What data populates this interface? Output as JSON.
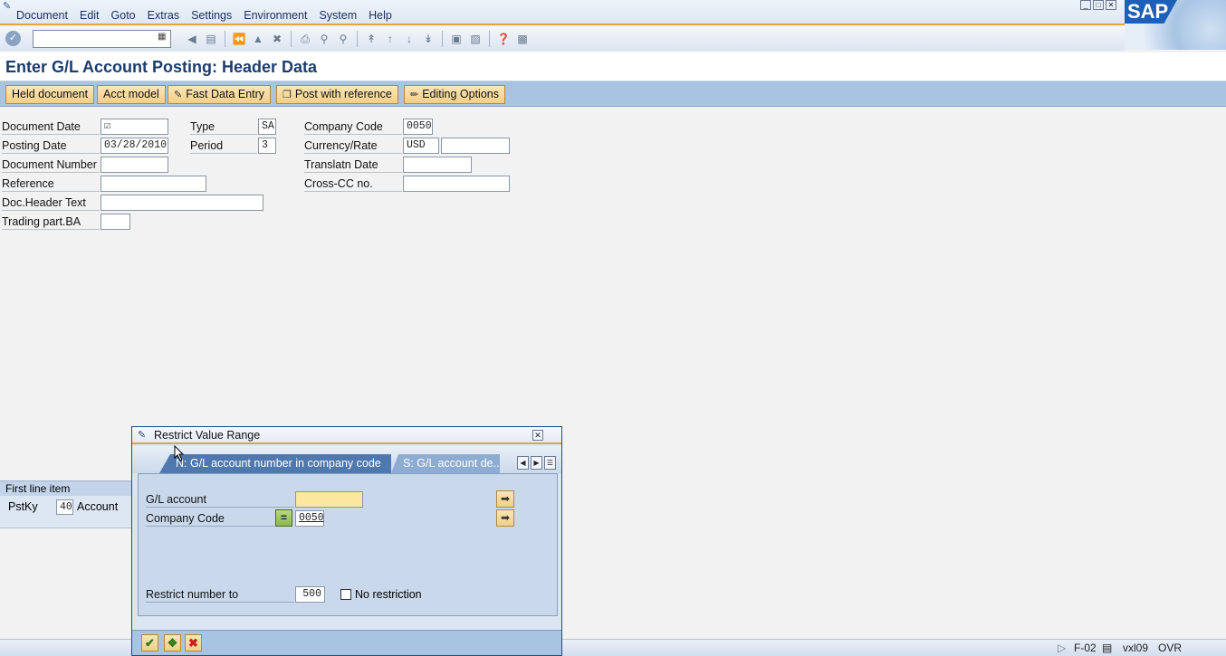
{
  "menu": {
    "items": [
      "Document",
      "Edit",
      "Goto",
      "Extras",
      "Settings",
      "Environment",
      "System",
      "Help"
    ]
  },
  "logo": {
    "text": "SAP"
  },
  "toolbar": {
    "command_value": "",
    "icons": [
      "enter-icon",
      "back-icon",
      "save-icon",
      "back-nav-icon",
      "exit-icon",
      "cancel-icon",
      "print-icon",
      "find-icon",
      "find-next-icon",
      "first-page-icon",
      "prev-page-icon",
      "next-page-icon",
      "last-page-icon",
      "new-session-icon",
      "shortcut-icon",
      "help-icon",
      "layout-icon"
    ]
  },
  "page": {
    "title": "Enter G/L Account Posting: Header Data"
  },
  "app_toolbar": {
    "held_document": "Held document",
    "acct_model": "Acct model",
    "fast_data_entry": "Fast Data Entry",
    "post_with_reference": "Post with reference",
    "editing_options": "Editing Options"
  },
  "header_form": {
    "document_date": {
      "label": "Document Date",
      "value": "☑"
    },
    "posting_date": {
      "label": "Posting Date",
      "value": "03/28/2010"
    },
    "document_number": {
      "label": "Document Number",
      "value": ""
    },
    "reference": {
      "label": "Reference",
      "value": ""
    },
    "doc_header_text": {
      "label": "Doc.Header Text",
      "value": ""
    },
    "trading_part_ba": {
      "label": "Trading part.BA",
      "value": ""
    },
    "type": {
      "label": "Type",
      "value": "SA"
    },
    "period": {
      "label": "Period",
      "value": "3"
    },
    "company_code": {
      "label": "Company Code",
      "value": "0050"
    },
    "currency_rate": {
      "label": "Currency/Rate",
      "value": "USD",
      "rate": ""
    },
    "translatn_date": {
      "label": "Translatn Date",
      "value": ""
    },
    "cross_cc_no": {
      "label": "Cross-CC no.",
      "value": ""
    }
  },
  "first_line_item": {
    "tab_label": "First line item",
    "pstky_label": "PstKy",
    "pstky_value": "40",
    "account_label": "Account"
  },
  "dialog": {
    "title": "Restrict Value Range",
    "tabs": [
      {
        "label": "N: G/L account number in company code",
        "active": true
      },
      {
        "label": "S: G/L account de...",
        "active": false
      }
    ],
    "gl_account": {
      "label": "G/L account",
      "value": ""
    },
    "company_code": {
      "label": "Company Code",
      "operator": "=",
      "value": "0050"
    },
    "restrict_number": {
      "label": "Restrict number to",
      "value": "500"
    },
    "no_restriction": {
      "label": "No restriction",
      "checked": false
    }
  },
  "status": {
    "transaction": "F-02",
    "server": "vxl09",
    "mode": "OVR"
  }
}
